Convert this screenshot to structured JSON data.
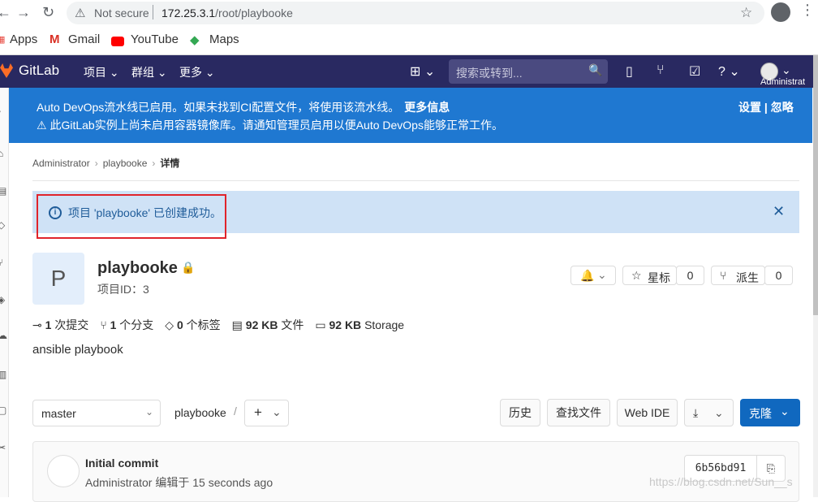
{
  "browser": {
    "not_secure": "Not secure",
    "url_host": "172.25.3.1",
    "url_path": "/root/playbooke",
    "bookmarks": [
      "Apps",
      "Gmail",
      "YouTube",
      "Maps"
    ]
  },
  "header": {
    "brand": "GitLab",
    "nav": [
      "项目",
      "群组",
      "更多"
    ],
    "search_placeholder": "搜索或转到...",
    "user": "Administrat"
  },
  "devops_banner": {
    "line1": "Auto DevOps流水线已启用。如果未找到CI配置文件，将使用该流水线。",
    "more_info": "更多信息",
    "line2": "此GitLab实例上尚未启用容器镜像库。请通知管理员启用以便Auto DevOps能够正常工作。",
    "settings": "设置",
    "sep": "|",
    "dismiss": "忽略"
  },
  "breadcrumb": [
    "Administrator",
    "playbooke",
    "详情"
  ],
  "flash": {
    "message": "项目 'playbooke' 已创建成功。"
  },
  "project": {
    "avatar_letter": "P",
    "name": "playbooke",
    "id_label": "项目ID：3",
    "star_label": "星标",
    "star_count": "0",
    "fork_label": "派生",
    "fork_count": "0",
    "description": "ansible playbook"
  },
  "stats": [
    {
      "value": "1",
      "label": "次提交"
    },
    {
      "value": "1",
      "label": "个分支"
    },
    {
      "value": "0",
      "label": "个标签"
    },
    {
      "value": "92 KB",
      "label": "文件"
    },
    {
      "value": "92 KB",
      "label": "Storage"
    }
  ],
  "tree": {
    "branch": "master",
    "path": "playbooke",
    "path_sep": "/",
    "history": "历史",
    "find_file": "查找文件",
    "web_ide": "Web IDE",
    "clone": "克隆"
  },
  "commit": {
    "title": "Initial commit",
    "author": "Administrator",
    "action": "编辑于",
    "time": "15 seconds ago",
    "sha": "6b56bd91"
  },
  "watermark": "https://blog.csdn.net/Sun__s",
  "colors": {
    "header_bg": "#292961",
    "banner_bg": "#1f78d1",
    "flash_bg": "#cfe2f6",
    "primary_btn": "#1068bf",
    "highlight_box": "#e0242b"
  }
}
